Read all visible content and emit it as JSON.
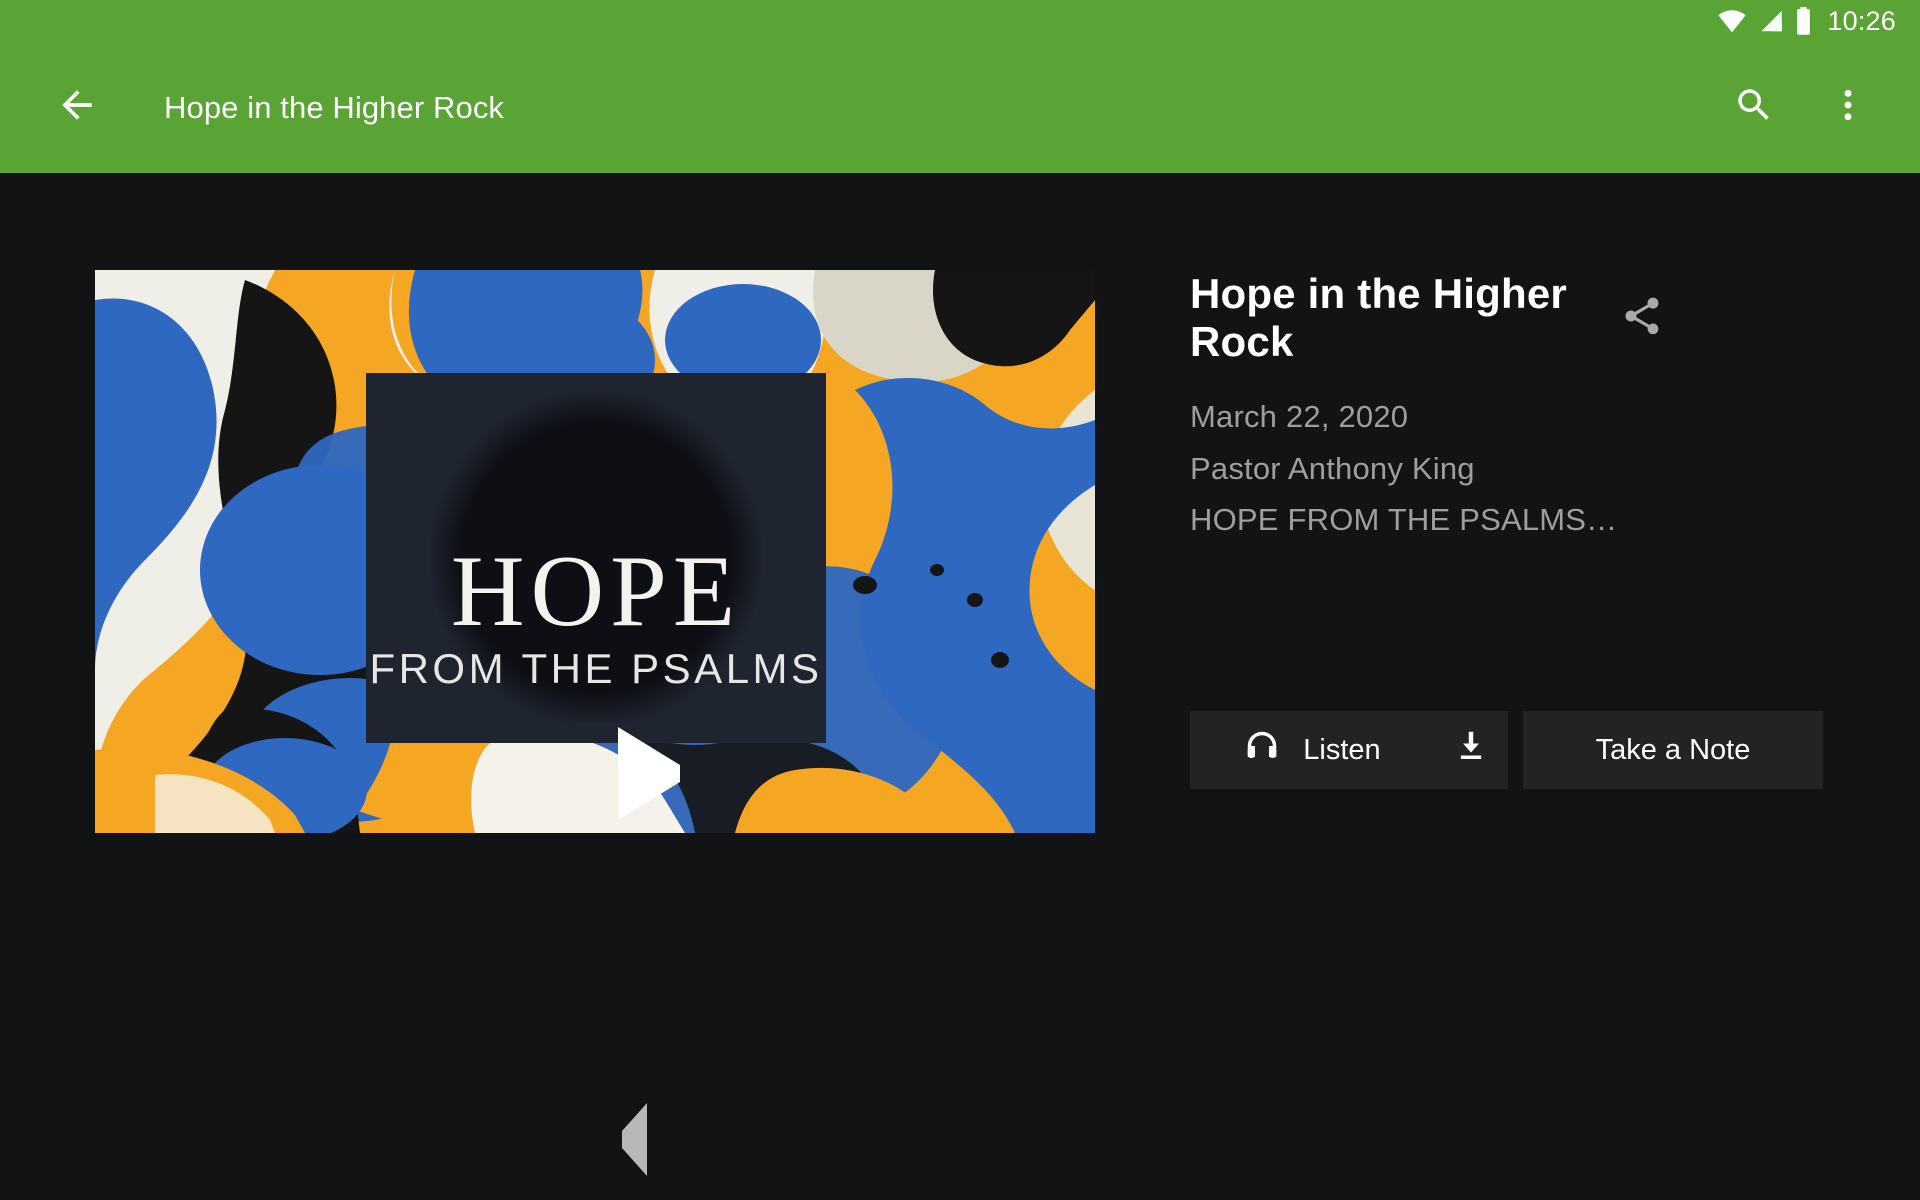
{
  "status_bar": {
    "time": "10:26",
    "icons": [
      "wifi-icon",
      "cell-signal-icon",
      "battery-icon"
    ]
  },
  "app_bar": {
    "back_icon": "arrow-back-icon",
    "title": "Hope in the Higher Rock",
    "search_icon": "search-icon",
    "overflow_icon": "more-vert-icon",
    "background_color": "#5aa335",
    "text_color": "#ffffff"
  },
  "media": {
    "thumbnail_alt": "marbled-paper-artwork",
    "overlay_title": "HOPE",
    "overlay_subtitle": "FROM THE PSALMS",
    "play_icon": "play-icon",
    "palette": [
      "#2f68c0",
      "#f5a623",
      "#f5f2ea",
      "#151515",
      "#1e2430"
    ]
  },
  "detail": {
    "title": "Hope in the Higher Rock",
    "share_icon": "share-icon",
    "meta": [
      "March 22, 2020",
      "Pastor Anthony King",
      "HOPE FROM THE PSALMS…"
    ],
    "meta_color": "#9e9e9e"
  },
  "actions": {
    "listen_label": "Listen",
    "listen_icon": "headphones-icon",
    "download_icon": "download-icon",
    "note_label": "Take a Note",
    "button_color": "#222324"
  },
  "nav_bar": {
    "back_icon": "nav-back-triangle-icon",
    "home_icon": "nav-home-circle-icon",
    "recents_icon": "nav-recents-square-icon"
  },
  "theme": {
    "background": "#121314",
    "accent": "#5aa335"
  }
}
